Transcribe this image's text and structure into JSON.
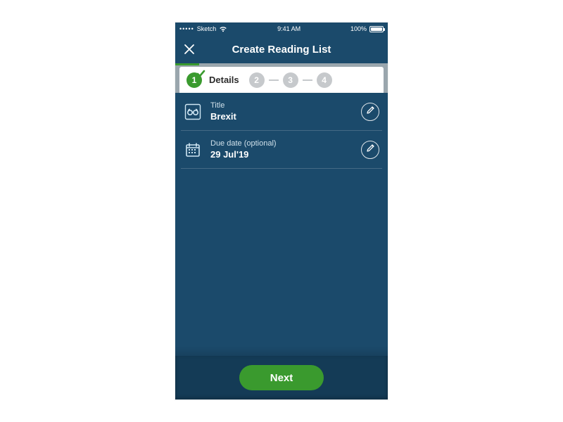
{
  "statusbar": {
    "carrier": "Sketch",
    "signal_dots": "•••••",
    "time": "9:41 AM",
    "battery_pct": "100%"
  },
  "navbar": {
    "title": "Create Reading List"
  },
  "steps": {
    "active_label": "Details",
    "pills": [
      "1",
      "2",
      "3",
      "4"
    ]
  },
  "rows": {
    "title": {
      "label": "Title",
      "value": "Brexit"
    },
    "due": {
      "label": "Due date (optional)",
      "value": "29 Jul'19"
    }
  },
  "footer": {
    "next_label": "Next"
  },
  "colors": {
    "bg": "#1b4a6b",
    "footer": "#143b56",
    "green": "#3a9a2e",
    "pill_inactive": "#c6c9cc"
  }
}
